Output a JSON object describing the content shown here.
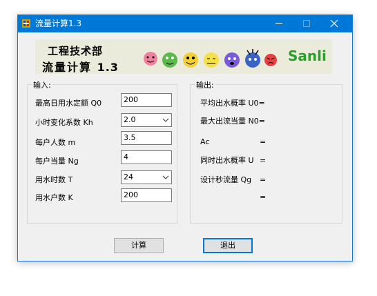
{
  "window": {
    "title": "流量计算1.3"
  },
  "banner": {
    "line1": "工程技术部",
    "line2": "流量计算",
    "version": "1.3",
    "brand": "Sanli"
  },
  "input_group": {
    "label": "输入:",
    "fields": [
      {
        "label": "最高日用水定额 Q0",
        "value": "200",
        "type": "text"
      },
      {
        "label": "小时变化系数 Kh",
        "value": "2.0",
        "type": "select"
      },
      {
        "label": "每户人数 m",
        "value": "3.5",
        "type": "text"
      },
      {
        "label": "每户当量 Ng",
        "value": "4",
        "type": "text"
      },
      {
        "label": "用水时数 T",
        "value": "24",
        "type": "select"
      },
      {
        "label": "用水户数 K",
        "value": "200",
        "type": "text"
      }
    ]
  },
  "output_group": {
    "label": "输出:",
    "rows": [
      {
        "label": "平均出水概率 U0=",
        "eq": ""
      },
      {
        "label": "最大出流当量 N0=",
        "eq": ""
      },
      {
        "label": "Ac",
        "eq": "="
      },
      {
        "label": "同时出水概率 U",
        "eq": "="
      },
      {
        "label": "设计秒流量 Qg",
        "eq": "="
      },
      {
        "label": "",
        "eq": "="
      }
    ]
  },
  "buttons": {
    "calc": "计算",
    "exit": "退出"
  },
  "colors": {
    "titlebar": "#0078d7",
    "brand": "#2aa02a"
  }
}
